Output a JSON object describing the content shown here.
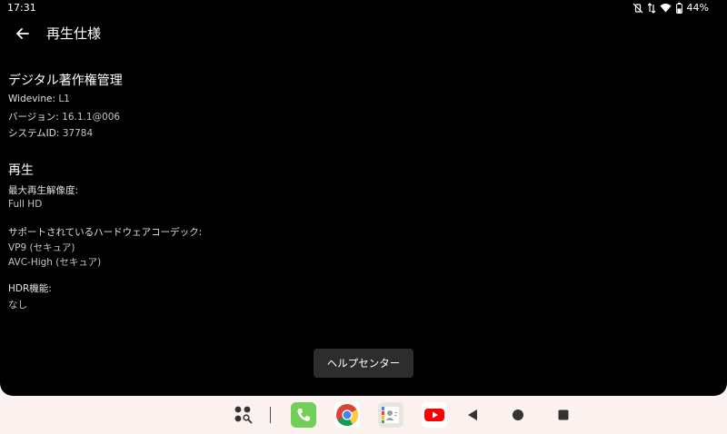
{
  "status": {
    "time": "17:31",
    "battery": "44%"
  },
  "header": {
    "title": "再生仕様"
  },
  "drm": {
    "heading": "デジタル著作権管理",
    "widevine_label": "Widevine:",
    "widevine_value": "L1",
    "version_label": "バージョン:",
    "version_value": "16.1.1@006",
    "system_id_label": "システムID:",
    "system_id_value": "37784"
  },
  "playback": {
    "heading": "再生",
    "max_res_label": "最大再生解像度:",
    "max_res_value": "Full HD",
    "codecs_label": "サポートされているハードウェアコーデック:",
    "codecs": [
      "VP9 (セキュア)",
      "AVC-High (セキュア)"
    ],
    "hdr_label": "HDR機能:",
    "hdr_value": "なし"
  },
  "help_button": {
    "label": "ヘルプセンター"
  },
  "taskbar": {
    "items": [
      "apps-icon",
      "phone-icon",
      "chrome-icon",
      "contacts-icon",
      "youtube-icon",
      "nav-back-icon",
      "nav-home-icon",
      "nav-recents-icon"
    ]
  },
  "colors": {
    "background": "#000000",
    "taskbar": "#fbf1ee",
    "help_button": "#2d2d2d"
  }
}
